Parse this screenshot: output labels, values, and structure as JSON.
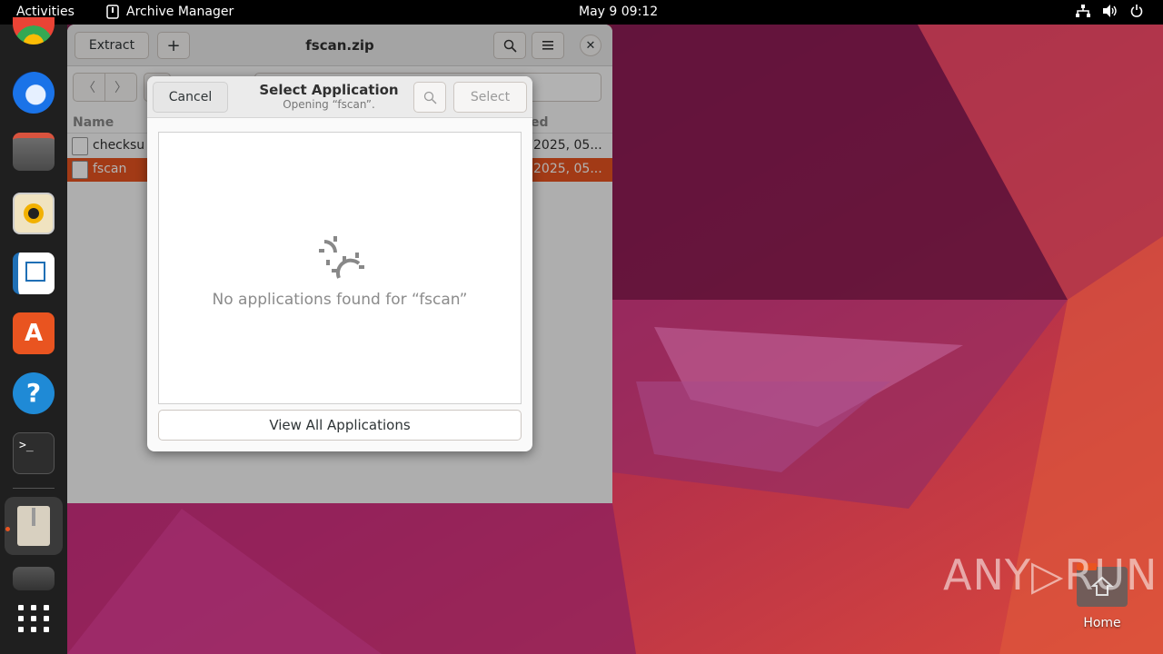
{
  "topbar": {
    "activities": "Activities",
    "app_name": "Archive Manager",
    "clock": "May 9  09:12"
  },
  "dock": {
    "items": [
      "chrome-icon",
      "thunderbird-icon",
      "files-icon",
      "rhythmbox-icon",
      "writer-icon",
      "app-center-icon",
      "help-icon",
      "terminal-icon",
      "archive-manager-icon",
      "drive-icon",
      "show-apps-icon"
    ]
  },
  "archive": {
    "extract_label": "Extract",
    "add_label": "+",
    "title": "fscan.zip",
    "column_name": "Name",
    "column_modified": "ed",
    "files": [
      {
        "name": "checksu",
        "date": "2025, 05..."
      },
      {
        "name": "fscan",
        "date": "2025, 05..."
      }
    ]
  },
  "dialog": {
    "cancel_label": "Cancel",
    "title": "Select Application",
    "subtitle": "Opening “fscan”.",
    "select_label": "Select",
    "empty_message": "No applications found for “fscan”",
    "view_all_label": "View All Applications"
  },
  "desktop": {
    "home_label": "Home",
    "watermark": "ANY▷RUN"
  },
  "colors": {
    "accent": "#e95420",
    "topbar": "#000000",
    "dock": "#1f1f1f"
  }
}
